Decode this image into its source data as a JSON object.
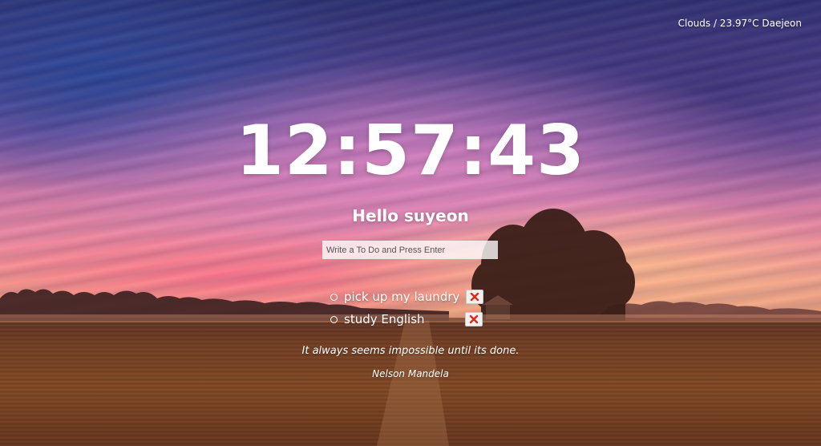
{
  "weather": {
    "text": "Clouds / 23.97°C Daejeon"
  },
  "clock": {
    "time": "12:57:43"
  },
  "greeting": {
    "text": "Hello suyeon"
  },
  "todo_form": {
    "placeholder": "Write a To Do and Press Enter",
    "value": ""
  },
  "todos": [
    {
      "text": "pick up my laundry",
      "delete_icon": "x-icon"
    },
    {
      "text": "study English",
      "delete_icon": "x-icon"
    }
  ],
  "quote": {
    "text": "It always seems impossible until its done.",
    "author": "Nelson Mandela"
  },
  "colors": {
    "text": "#ffffff",
    "delete_x": "#e0261b"
  }
}
